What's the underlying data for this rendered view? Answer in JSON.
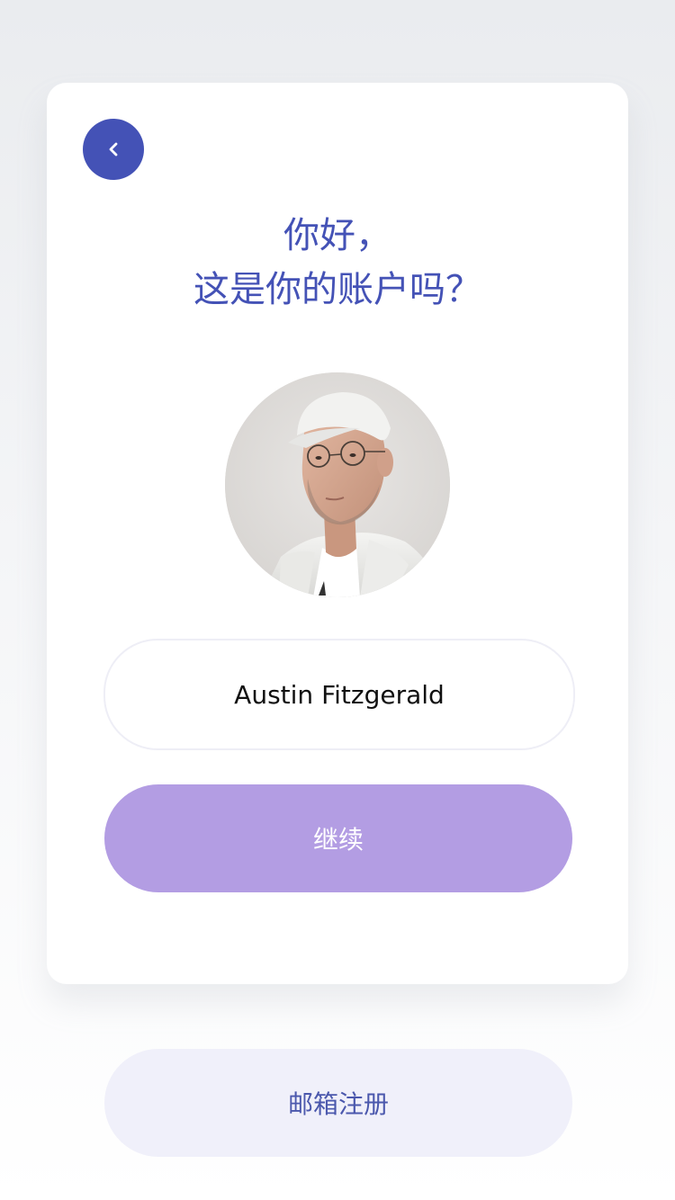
{
  "header": {
    "back_icon": "chevron-left-icon"
  },
  "greeting": {
    "line1": "你好，",
    "line2": "这是你的账户吗？"
  },
  "account": {
    "name": "Austin Fitzgerald",
    "avatar": "user-avatar-photo"
  },
  "actions": {
    "continue_label": "继续",
    "email_register_label": "邮箱注册"
  },
  "colors": {
    "accent": "#4452b6",
    "continue_bg": "#b39de3",
    "secondary_bg": "#f0f0fa",
    "secondary_text": "#4b58ad"
  }
}
